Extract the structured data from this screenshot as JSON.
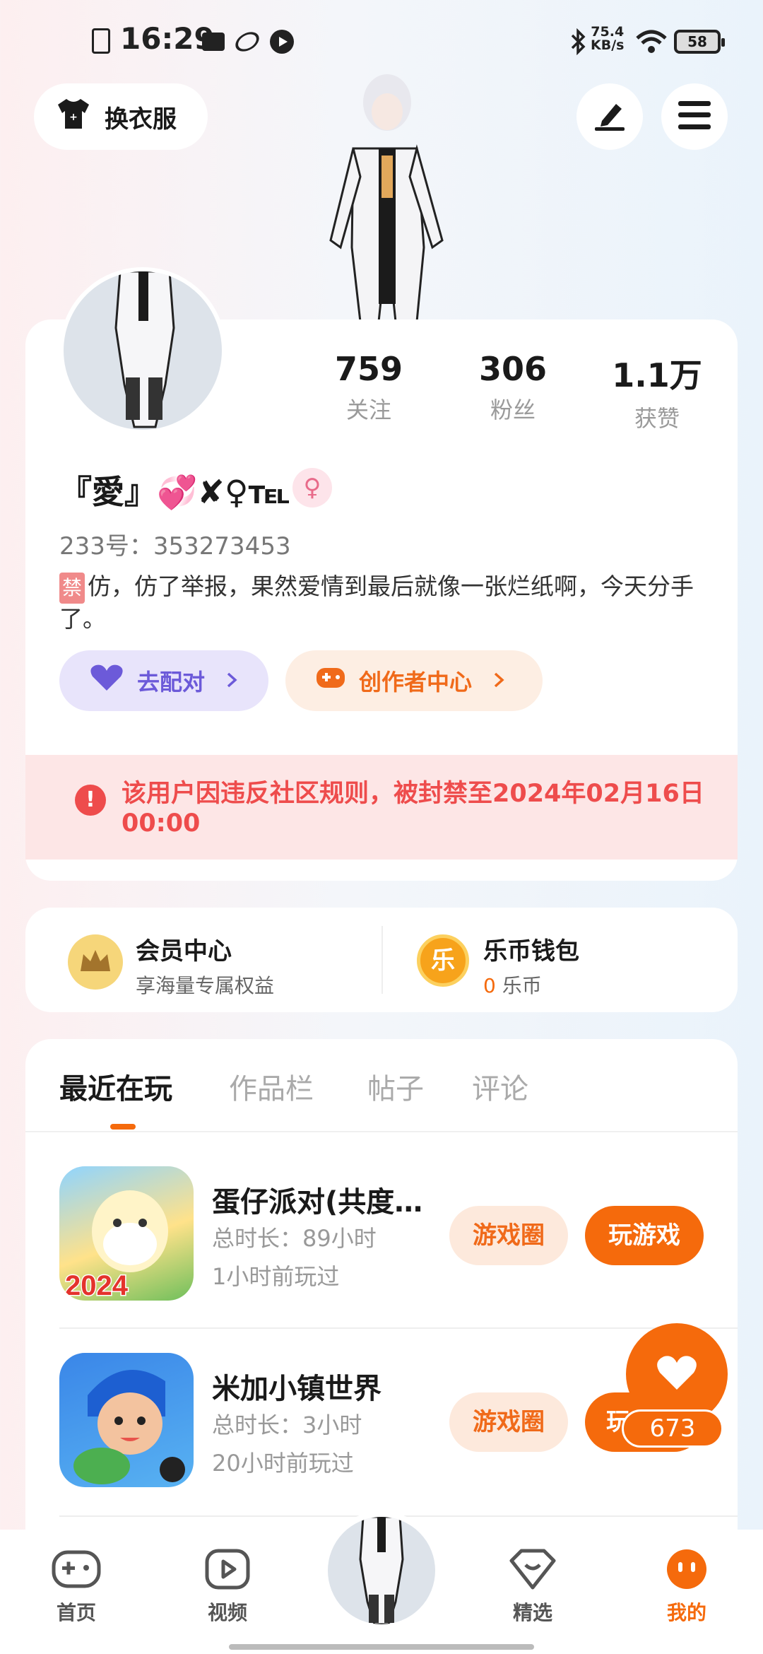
{
  "status_bar": {
    "time": "16:29",
    "net_speed_value": "75.4",
    "net_speed_unit": "KB/s",
    "battery": "58"
  },
  "top": {
    "outfit_label": "换衣服"
  },
  "profile": {
    "stats": [
      {
        "value": "759",
        "label": "关注"
      },
      {
        "value": "306",
        "label": "粉丝"
      },
      {
        "value": "1.1万",
        "label": "获赞"
      }
    ],
    "nickname": "『愛』💞✘♀℡",
    "uid": "233号：353273453",
    "bio_tag": "禁",
    "bio": "仿，仿了举报，果然爱情到最后就像一张烂纸啊，今天分手了。",
    "match_label": "去配对",
    "creator_label": "创作者中心",
    "ban_notice": "该用户因违反社区规则，被封禁至2024年02月16日 00:00"
  },
  "member": {
    "vip_title": "会员中心",
    "vip_sub": "享海量专属权益",
    "wallet_title": "乐币钱包",
    "wallet_amount": "0",
    "wallet_unit": "乐币",
    "coin_glyph": "乐"
  },
  "tabs": [
    "最近在玩",
    "作品栏",
    "帖子",
    "评论"
  ],
  "games": [
    {
      "name": "蛋仔派对(共度…",
      "duration": "总时长：89小时",
      "last_played": "1小时前玩过",
      "circle_label": "游戏圈",
      "play_label": "玩游戏",
      "badge": "2024"
    },
    {
      "name": "米加小镇世界",
      "duration": "总时长：3小时",
      "last_played": "20小时前玩过",
      "circle_label": "游戏圈",
      "play_label": "玩"
    }
  ],
  "floating": {
    "count": "673"
  },
  "bottom_nav": [
    {
      "label": "首页"
    },
    {
      "label": "视频"
    },
    {
      "label": "精选"
    },
    {
      "label": "我的"
    }
  ],
  "colors": {
    "accent": "#f56a0c",
    "ban_red": "#ee4c4c",
    "purple": "#6c5ad9"
  }
}
